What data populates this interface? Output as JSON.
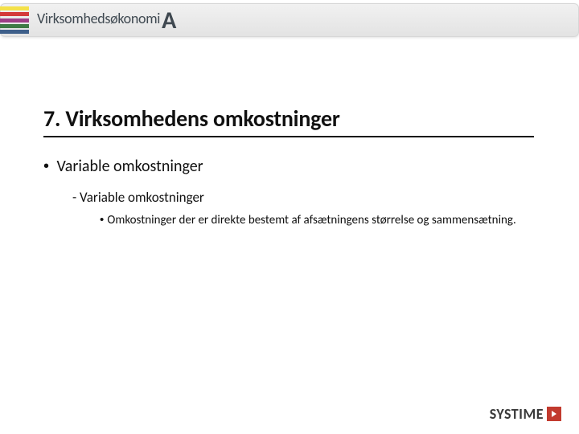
{
  "header": {
    "brand_light": "Virksomheds",
    "brand_ok": "økonomi",
    "level_letter": "A"
  },
  "title": "7. Virksomhedens omkostninger",
  "bullets": {
    "lvl1": "Variable omkostninger",
    "lvl2": "- Variable omkostninger",
    "lvl3": "Omkostninger der er direkte bestemt af afsætningens størrelse og sammensætning."
  },
  "footer": {
    "brand": "SYSTIME"
  }
}
